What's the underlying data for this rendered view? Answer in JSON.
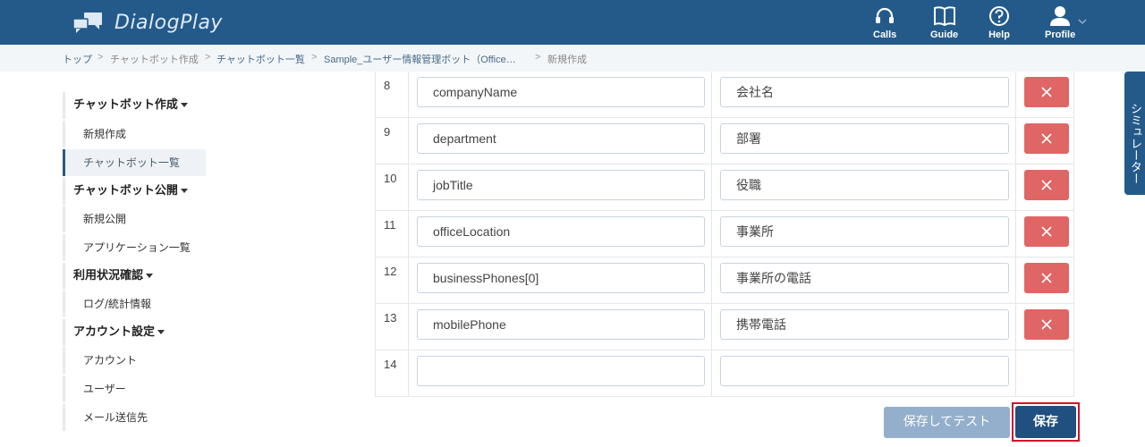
{
  "app": {
    "title": "DialogPlay"
  },
  "colors": {
    "header": "#245a8a",
    "delete": "#e06565",
    "save": "#1f5080",
    "save_highlight": "#d0142b"
  },
  "nav": [
    {
      "label": "Calls",
      "icon": "headset-icon"
    },
    {
      "label": "Guide",
      "icon": "book-icon"
    },
    {
      "label": "Help",
      "icon": "help-icon"
    },
    {
      "label": "Profile",
      "icon": "user-icon"
    }
  ],
  "breadcrumb": [
    "トップ",
    "チャットボット作成",
    "チャットボット一覧",
    "Sample_ユーザー情報管理ボット（Office…",
    "新規作成"
  ],
  "sidebar": {
    "sections": [
      {
        "title": "チャットボット作成",
        "items": [
          "新規作成",
          "チャットボット一覧"
        ]
      },
      {
        "title": "チャットボット公開",
        "items": [
          "新規公開",
          "アプリケーション一覧"
        ]
      },
      {
        "title": "利用状況確認",
        "items": [
          "ログ/統計情報"
        ]
      },
      {
        "title": "アカウント設定",
        "items": [
          "アカウント",
          "ユーザー",
          "メール送信先"
        ]
      }
    ],
    "active": "チャットボット一覧"
  },
  "rows": [
    {
      "num": "8",
      "key": "companyName",
      "label": "会社名"
    },
    {
      "num": "9",
      "key": "department",
      "label": "部署"
    },
    {
      "num": "10",
      "key": "jobTitle",
      "label": "役職"
    },
    {
      "num": "11",
      "key": "officeLocation",
      "label": "事業所"
    },
    {
      "num": "12",
      "key": "businessPhones[0]",
      "label": "事業所の電話"
    },
    {
      "num": "13",
      "key": "mobilePhone",
      "label": "携帯電話"
    },
    {
      "num": "14",
      "key": "",
      "label": ""
    }
  ],
  "buttons": {
    "save_and_test": "保存してテスト",
    "save": "保存"
  },
  "simulator": {
    "label": "シミュレーター"
  }
}
